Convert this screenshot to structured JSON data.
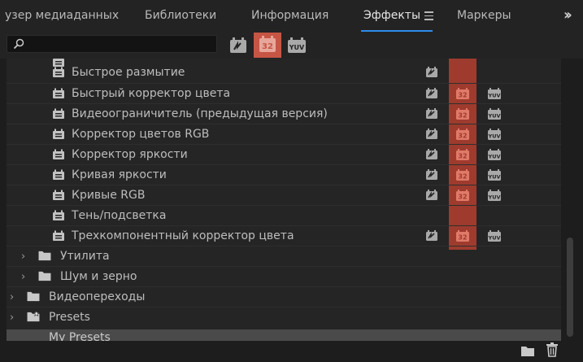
{
  "tabs": [
    {
      "label": "узер медиаданных",
      "active": false
    },
    {
      "label": "Библиотеки",
      "active": false
    },
    {
      "label": "Информация",
      "active": false
    },
    {
      "label": "Эффекты",
      "active": true
    },
    {
      "label": "Маркеры",
      "active": false
    }
  ],
  "more_tabs_icon": "double-chevron-right-icon",
  "search": {
    "value": "",
    "icon": "search-icon"
  },
  "filters": {
    "accelerated_icon": "accelerated-effects-icon",
    "bit32_label": "32",
    "yuv_label": "YUV",
    "bit32_active_color": "#c65545"
  },
  "effects": [
    {
      "label": "Быстрое размытие",
      "accelerated": true,
      "bit32": false,
      "yuv": false
    },
    {
      "label": "Быстрый корректор цвета",
      "accelerated": true,
      "bit32": true,
      "yuv": true
    },
    {
      "label": "Видеоограничитель (предыдущая версия)",
      "accelerated": true,
      "bit32": true,
      "yuv": true
    },
    {
      "label": "Корректор цветов RGB",
      "accelerated": true,
      "bit32": true,
      "yuv": true
    },
    {
      "label": "Корректор яркости",
      "accelerated": true,
      "bit32": true,
      "yuv": true
    },
    {
      "label": "Кривая яркости",
      "accelerated": true,
      "bit32": true,
      "yuv": true
    },
    {
      "label": "Кривые RGB",
      "accelerated": true,
      "bit32": true,
      "yuv": true
    },
    {
      "label": "Тень/подсветка",
      "accelerated": false,
      "bit32": false,
      "yuv": false
    },
    {
      "label": "Трехкомпонентный корректор цвета",
      "accelerated": true,
      "bit32": true,
      "yuv": true
    }
  ],
  "subfolders": [
    {
      "label": "Утилита"
    },
    {
      "label": "Шум и зерно"
    }
  ],
  "folders": [
    {
      "label": "Видеопереходы",
      "icon": "folder-icon"
    },
    {
      "label": "Presets",
      "icon": "presets-folder-star-icon"
    }
  ],
  "selected_folder": {
    "label": "My Presets"
  },
  "bottom_bar": {
    "new_folder_icon": "new-bin-icon",
    "delete_icon": "trash-icon"
  }
}
